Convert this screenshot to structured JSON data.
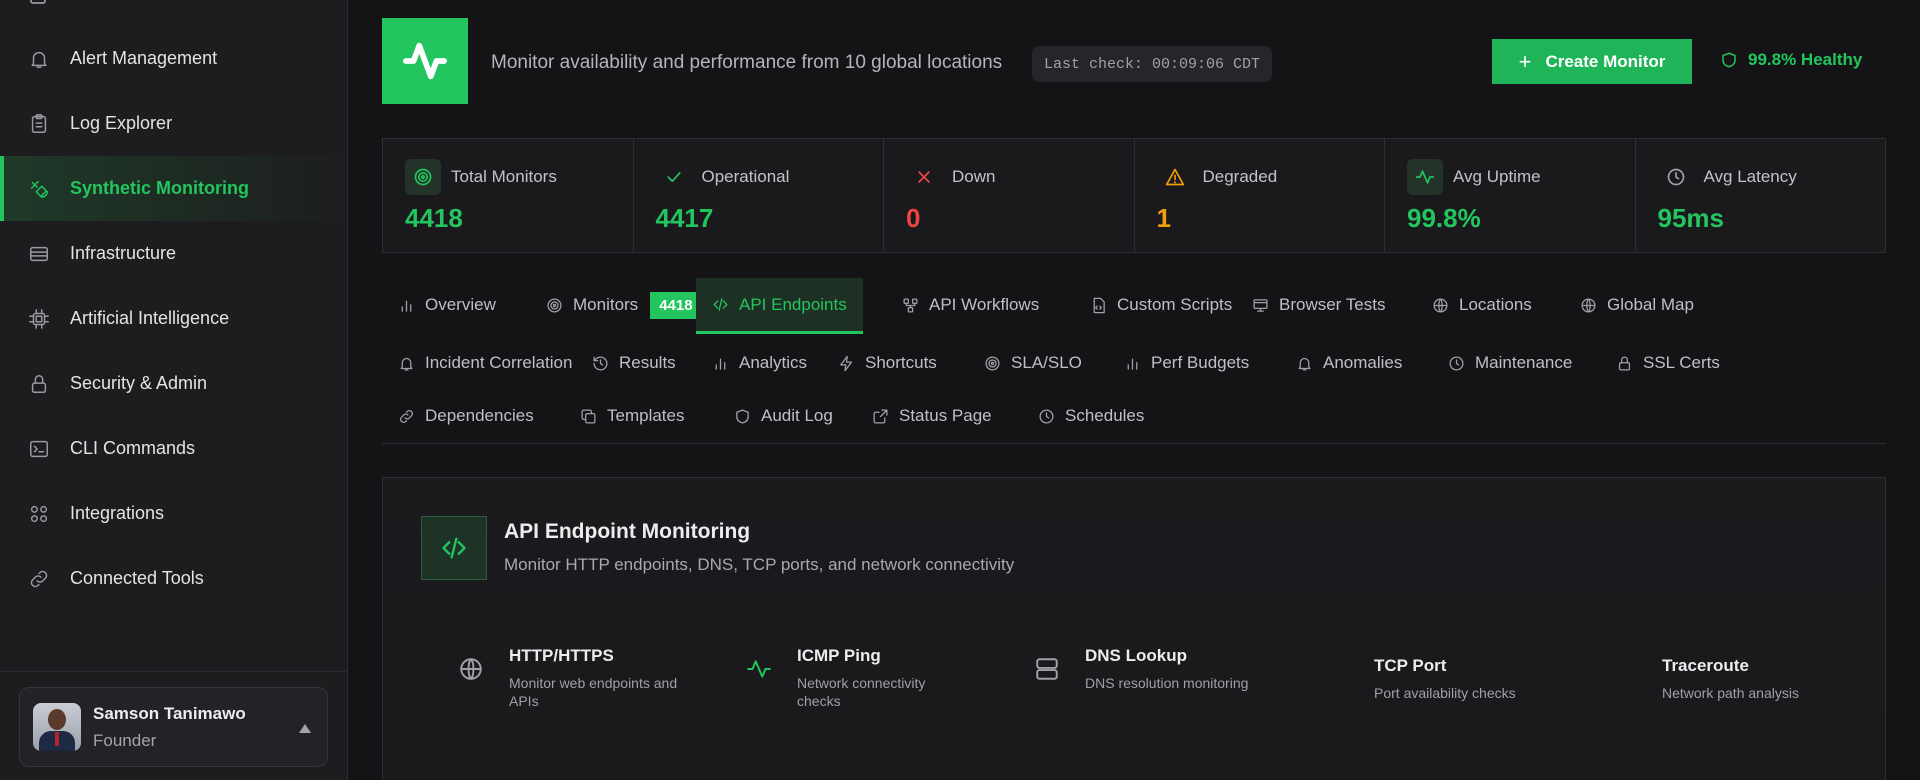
{
  "sidebar": {
    "items": [
      {
        "label": "Alert Management",
        "icon": "bell-icon"
      },
      {
        "label": "Log Explorer",
        "icon": "clipboard-icon"
      },
      {
        "label": "Synthetic Monitoring",
        "icon": "satellite-icon",
        "active": true
      },
      {
        "label": "Infrastructure",
        "icon": "server-icon"
      },
      {
        "label": "Artificial Intelligence",
        "icon": "chip-icon"
      },
      {
        "label": "Security & Admin",
        "icon": "lock-icon"
      },
      {
        "label": "CLI Commands",
        "icon": "terminal-icon"
      },
      {
        "label": "Integrations",
        "icon": "grid-icon"
      },
      {
        "label": "Connected Tools",
        "icon": "link-icon"
      }
    ],
    "user": {
      "name": "Samson Tanimawo",
      "role": "Founder"
    }
  },
  "header": {
    "subtitle": "Monitor availability and performance from 10 global locations",
    "last_check": "Last check: 00:09:06 CDT",
    "create_label": "Create Monitor",
    "health_label": "99.8% Healthy"
  },
  "stats": [
    {
      "label": "Total Monitors",
      "value": "4418",
      "color": "#22c55e",
      "icon": "target-icon"
    },
    {
      "label": "Operational",
      "value": "4417",
      "color": "#22c55e",
      "icon": "check-icon"
    },
    {
      "label": "Down",
      "value": "0",
      "color": "#ef4444",
      "icon": "x-icon"
    },
    {
      "label": "Degraded",
      "value": "1",
      "color": "#f59e0b",
      "icon": "warning-icon"
    },
    {
      "label": "Avg Uptime",
      "value": "99.8%",
      "color": "#22c55e",
      "icon": "pulse-icon"
    },
    {
      "label": "Avg Latency",
      "value": "95ms",
      "color": "#22c55e",
      "icon": "clock-icon"
    }
  ],
  "tabs": {
    "overview": "Overview",
    "monitors": "Monitors",
    "monitors_badge": "4418",
    "api_endpoints": "API Endpoints",
    "api_workflows": "API Workflows",
    "custom_scripts": "Custom Scripts",
    "browser_tests": "Browser Tests",
    "locations": "Locations",
    "global_map": "Global Map",
    "incident_correlation": "Incident Correlation",
    "results": "Results",
    "analytics": "Analytics",
    "shortcuts": "Shortcuts",
    "sla_slo": "SLA/SLO",
    "perf_budgets": "Perf Budgets",
    "anomalies": "Anomalies",
    "maintenance": "Maintenance",
    "ssl_certs": "SSL Certs",
    "dependencies": "Dependencies",
    "templates": "Templates",
    "audit_log": "Audit Log",
    "status_page": "Status Page",
    "schedules": "Schedules"
  },
  "panel": {
    "title": "API Endpoint Monitoring",
    "subtitle": "Monitor HTTP endpoints, DNS, TCP ports, and network connectivity",
    "features": [
      {
        "title": "HTTP/HTTPS",
        "desc": "Monitor web endpoints and APIs"
      },
      {
        "title": "ICMP Ping",
        "desc": "Network connectivity checks"
      },
      {
        "title": "DNS Lookup",
        "desc": "DNS resolution monitoring"
      },
      {
        "title": "TCP Port",
        "desc": "Port availability checks"
      },
      {
        "title": "Traceroute",
        "desc": "Network path analysis"
      }
    ]
  }
}
